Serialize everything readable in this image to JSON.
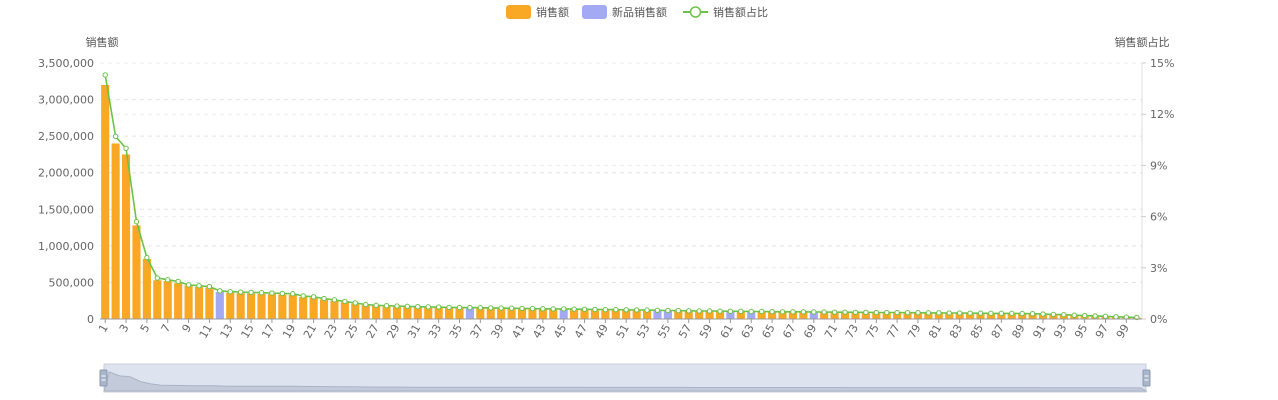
{
  "chart_data": {
    "type": "bar",
    "title": "",
    "categories": [
      "1",
      "2",
      "3",
      "4",
      "5",
      "6",
      "7",
      "8",
      "9",
      "10",
      "11",
      "12",
      "13",
      "14",
      "15",
      "16",
      "17",
      "18",
      "19",
      "20",
      "21",
      "22",
      "23",
      "24",
      "25",
      "26",
      "27",
      "28",
      "29",
      "30",
      "31",
      "32",
      "33",
      "34",
      "35",
      "36",
      "37",
      "38",
      "39",
      "40",
      "41",
      "42",
      "43",
      "44",
      "45",
      "46",
      "47",
      "48",
      "49",
      "50",
      "51",
      "52",
      "53",
      "54",
      "55",
      "56",
      "57",
      "58",
      "59",
      "60",
      "61",
      "62",
      "63",
      "64",
      "65",
      "66",
      "67",
      "68",
      "69",
      "70",
      "71",
      "72",
      "73",
      "74",
      "75",
      "76",
      "77",
      "78",
      "79",
      "80",
      "81",
      "82",
      "83",
      "84",
      "85",
      "86",
      "87",
      "88",
      "89",
      "90",
      "91",
      "92",
      "93",
      "94",
      "95",
      "96",
      "97",
      "98",
      "99",
      "100"
    ],
    "x_tick_labels": [
      "1",
      "3",
      "5",
      "7",
      "9",
      "11",
      "13",
      "15",
      "17",
      "19",
      "21",
      "23",
      "25",
      "27",
      "29",
      "31",
      "33",
      "35",
      "37",
      "39",
      "41",
      "43",
      "45",
      "47",
      "49",
      "51",
      "53",
      "55",
      "57",
      "59",
      "61",
      "63",
      "65",
      "67",
      "69",
      "71",
      "73",
      "75",
      "77",
      "79",
      "81",
      "83",
      "85",
      "87",
      "89",
      "91",
      "93",
      "95",
      "97",
      "99"
    ],
    "series": [
      {
        "name": "销售额",
        "type": "bar",
        "color": "#F9A825",
        "values": [
          3200000,
          2400000,
          2250000,
          1280000,
          820000,
          530000,
          520000,
          490000,
          460000,
          440000,
          430000,
          0,
          360000,
          355000,
          350000,
          345000,
          340000,
          335000,
          330000,
          300000,
          290000,
          270000,
          250000,
          230000,
          210000,
          190000,
          180000,
          175000,
          170000,
          165000,
          160000,
          158000,
          155000,
          152000,
          150000,
          0,
          148000,
          145000,
          143000,
          140000,
          138000,
          136000,
          134000,
          132000,
          0,
          130000,
          128000,
          126000,
          124000,
          122000,
          120000,
          118000,
          116000,
          0,
          0,
          110000,
          108000,
          106000,
          104000,
          102000,
          0,
          100000,
          0,
          98000,
          96000,
          95000,
          94000,
          93000,
          0,
          91000,
          90000,
          89000,
          88000,
          87000,
          86000,
          85000,
          84000,
          83000,
          82000,
          81000,
          80000,
          79000,
          78000,
          77000,
          76000,
          75000,
          74000,
          73000,
          72000,
          70000,
          65000,
          60000,
          55000,
          50000,
          45000,
          40000,
          35000,
          30000,
          25000,
          20000
        ]
      },
      {
        "name": "新品销售额",
        "type": "bar",
        "color": "#A3A9F2",
        "values": [
          0,
          0,
          0,
          0,
          0,
          0,
          0,
          0,
          0,
          0,
          0,
          370000,
          0,
          0,
          0,
          0,
          0,
          0,
          0,
          0,
          0,
          0,
          0,
          0,
          0,
          0,
          0,
          0,
          0,
          0,
          0,
          0,
          0,
          0,
          0,
          150000,
          0,
          0,
          0,
          0,
          0,
          0,
          0,
          0,
          131000,
          0,
          0,
          0,
          0,
          0,
          0,
          0,
          0,
          115000,
          112000,
          0,
          0,
          0,
          0,
          0,
          101000,
          0,
          99000,
          0,
          0,
          0,
          0,
          0,
          92000,
          0,
          0,
          0,
          0,
          0,
          0,
          0,
          0,
          0,
          0,
          0,
          0,
          0,
          0,
          0,
          0,
          0,
          0,
          0,
          0,
          0,
          0,
          0,
          0,
          0,
          0,
          0,
          0,
          0,
          0,
          0
        ]
      },
      {
        "name": "销售额占比",
        "type": "line",
        "color": "#6CC24A",
        "axis": "right",
        "values": [
          14.3,
          10.7,
          10.0,
          5.7,
          3.6,
          2.4,
          2.3,
          2.2,
          2.0,
          1.95,
          1.9,
          1.65,
          1.6,
          1.58,
          1.56,
          1.54,
          1.52,
          1.5,
          1.48,
          1.35,
          1.3,
          1.2,
          1.12,
          1.03,
          0.94,
          0.85,
          0.8,
          0.78,
          0.76,
          0.74,
          0.72,
          0.71,
          0.7,
          0.68,
          0.67,
          0.67,
          0.66,
          0.65,
          0.64,
          0.63,
          0.62,
          0.61,
          0.6,
          0.59,
          0.59,
          0.58,
          0.57,
          0.56,
          0.55,
          0.55,
          0.54,
          0.53,
          0.52,
          0.51,
          0.5,
          0.49,
          0.48,
          0.47,
          0.47,
          0.46,
          0.45,
          0.45,
          0.44,
          0.44,
          0.43,
          0.42,
          0.42,
          0.42,
          0.41,
          0.41,
          0.4,
          0.4,
          0.39,
          0.39,
          0.38,
          0.38,
          0.38,
          0.37,
          0.37,
          0.36,
          0.36,
          0.35,
          0.35,
          0.34,
          0.34,
          0.33,
          0.33,
          0.33,
          0.32,
          0.31,
          0.29,
          0.27,
          0.25,
          0.22,
          0.2,
          0.18,
          0.16,
          0.13,
          0.11,
          0.09
        ]
      }
    ],
    "y_left": {
      "label": "销售额",
      "ylim": [
        0,
        3500000
      ],
      "ticks": [
        0,
        500000,
        1000000,
        1500000,
        2000000,
        2500000,
        3000000,
        3500000
      ],
      "tick_labels": [
        "0",
        "500,000",
        "1,000,000",
        "1,500,000",
        "2,000,000",
        "2,500,000",
        "3,000,000",
        "3,500,000"
      ]
    },
    "y_right": {
      "label": "销售额占比",
      "ylim": [
        0,
        15
      ],
      "ticks": [
        0,
        3,
        6,
        9,
        12,
        15
      ],
      "tick_labels": [
        "0%",
        "3%",
        "6%",
        "9%",
        "12%",
        "15%"
      ]
    },
    "legend": {
      "placement": "top-center",
      "items": [
        "销售额",
        "新品销售额",
        "销售额占比"
      ]
    },
    "grid": true,
    "data_zoom": {
      "visible": true,
      "start_percent": 0,
      "end_percent": 100
    }
  }
}
